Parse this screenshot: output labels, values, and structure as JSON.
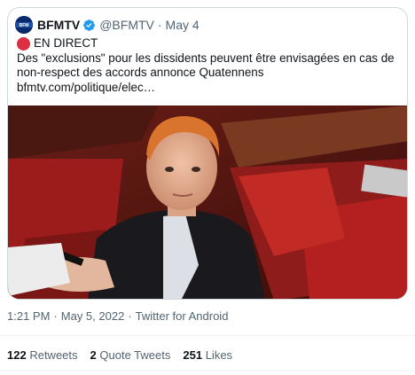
{
  "quoted": {
    "name": "BFMTV",
    "handle": "@BFMTV",
    "dot": "·",
    "date": "May 4",
    "live_label": "EN DIRECT",
    "text": "Des \"exclusions\" pour les dissidents peuvent être envisagées en cas de non-respect des accords annonce Quatennens",
    "link": "bfmtv.com/politique/elec…",
    "avatar_icon": "bfmtv-logo",
    "verified_icon": "verified-badge-icon",
    "colors": {
      "verified": "#1d9bf0",
      "live_dot": "#dd2e44"
    }
  },
  "meta": {
    "time": "1:21 PM",
    "sep": "·",
    "date": "May 5, 2022",
    "source": "Twitter for Android"
  },
  "stats": {
    "retweets_count": "122",
    "retweets_label": "Retweets",
    "quotes_count": "2",
    "quotes_label": "Quote Tweets",
    "likes_count": "251",
    "likes_label": "Likes"
  }
}
